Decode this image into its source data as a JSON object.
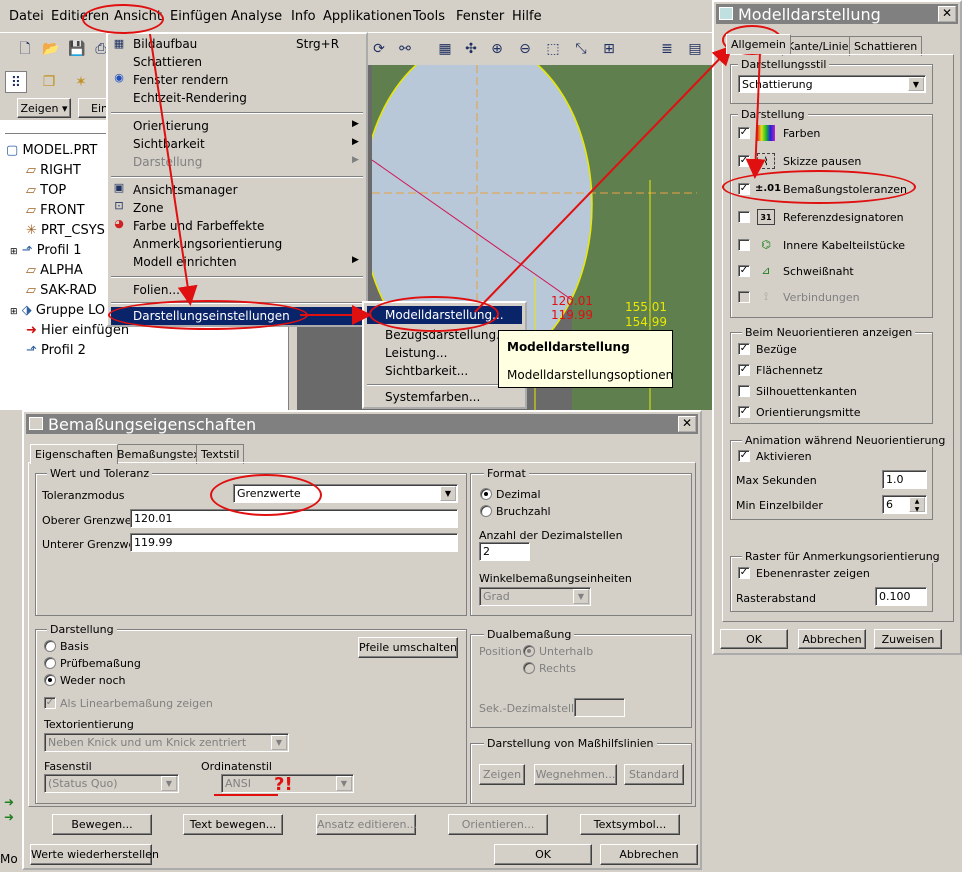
{
  "menubar": {
    "items": [
      "Datei",
      "Editieren",
      "Ansicht",
      "Einfügen",
      "Analyse",
      "Info",
      "Applikationen",
      "Tools",
      "Fenster",
      "Hilfe"
    ]
  },
  "toolbar": {
    "zeigen_label": "Zeigen ▾",
    "ein_label": "Ein"
  },
  "model_tree": {
    "items": [
      "MODEL.PRT",
      "RIGHT",
      "TOP",
      "FRONT",
      "PRT_CSYS",
      "Profil 1",
      "ALPHA",
      "SAK-RAD",
      "Gruppe LO",
      "Hier einfügen",
      "Profil 2"
    ]
  },
  "ansicht_menu": {
    "items": [
      {
        "label": "Bildaufbau",
        "shortcut": "Strg+R"
      },
      {
        "label": "Schattieren"
      },
      {
        "label": "Fenster rendern"
      },
      {
        "label": "Echtzeit-Rendering"
      },
      {
        "label": "Orientierung"
      },
      {
        "label": "Sichtbarkeit"
      },
      {
        "label": "Darstellung"
      },
      {
        "label": "Ansichtsmanager"
      },
      {
        "label": "Zone"
      },
      {
        "label": "Farbe und Farbeffekte"
      },
      {
        "label": "Anmerkungsorientierung"
      },
      {
        "label": "Modell einrichten"
      },
      {
        "label": "Folien..."
      },
      {
        "label": "Darstellungseinstellungen"
      }
    ]
  },
  "submenu": {
    "items": [
      "Modelldarstellung...",
      "Bezugsdarstellung...",
      "Leistung...",
      "Sichtbarkeit...",
      "Systemfarben..."
    ]
  },
  "tooltip": {
    "title": "Modelldarstellung",
    "text": "Modelldarstellungsoptionen"
  },
  "viewport": {
    "dim_upper_red": "120.01",
    "dim_lower_red": "119.99",
    "dim_upper_yellow": "155.01",
    "dim_lower_yellow": "154.99"
  },
  "modelldarstellung": {
    "title": "Modelldarstellung",
    "tabs": [
      "Allgemein",
      "Kante/Linie",
      "Schattieren"
    ],
    "stil_group": "Darstellungsstil",
    "stil_value": "Schattierung",
    "darstellung_group": "Darstellung",
    "darstellung_items": [
      {
        "label": "Farben",
        "checked": true,
        "disabled": false
      },
      {
        "label": "Skizze pausen",
        "checked": true,
        "disabled": false
      },
      {
        "label": "Bemaßungstoleranzen",
        "checked": true,
        "disabled": false
      },
      {
        "label": "Referenzdesignatoren",
        "checked": false,
        "disabled": false
      },
      {
        "label": "Innere Kabelteilstücke",
        "checked": false,
        "disabled": false
      },
      {
        "label": "Schweißnaht",
        "checked": true,
        "disabled": false
      },
      {
        "label": "Verbindungen",
        "checked": false,
        "disabled": true
      }
    ],
    "tol_icon_text": "±.01",
    "ref_icon_text": "31",
    "neuorient_group": "Beim Neuorientieren anzeigen",
    "neuorient_items": [
      {
        "label": "Bezüge",
        "checked": true
      },
      {
        "label": "Flächennetz",
        "checked": true
      },
      {
        "label": "Silhouettenkanten",
        "checked": false
      },
      {
        "label": "Orientierungsmitte",
        "checked": true
      }
    ],
    "animation_group": "Animation während Neuorientierung",
    "aktivieren_label": "Aktivieren",
    "max_sek_label": "Max Sekunden",
    "max_sek_value": "1.0",
    "min_bilder_label": "Min Einzelbilder",
    "min_bilder_value": "6",
    "raster_group": "Raster für Anmerkungsorientierung",
    "ebenenraster_label": "Ebenenraster zeigen",
    "rasterabstand_label": "Rasterabstand",
    "rasterabstand_value": "0.100",
    "ok_label": "OK",
    "abbrechen_label": "Abbrechen",
    "zuweisen_label": "Zuweisen"
  },
  "bemassung": {
    "title": "Bemaßungseigenschaften",
    "tabs": [
      "Eigenschaften",
      "Bemaßungstext",
      "Textstil"
    ],
    "wert_group": "Wert und Toleranz",
    "toleranzmodus_label": "Toleranzmodus",
    "toleranzmodus_value": "Grenzwerte",
    "oberer_label": "Oberer Grenzwert",
    "oberer_value": "120.01",
    "unterer_label": "Unterer Grenzwert",
    "unterer_value": "119.99",
    "format_group": "Format",
    "dezimal_label": "Dezimal",
    "bruchzahl_label": "Bruchzahl",
    "dezimalstellen_label": "Anzahl der Dezimalstellen",
    "dezimalstellen_value": "2",
    "winkel_label": "Winkelbemaßungseinheiten",
    "winkel_value": "Grad",
    "darstellung_group": "Darstellung",
    "basis_label": "Basis",
    "pruef_label": "Prüfbemaßung",
    "weder_label": "Weder noch",
    "pfeile_label": "Pfeile umschalten",
    "linear_label": "Als Linearbemaßung zeigen",
    "textorient_label": "Textorientierung",
    "textorient_value": "Neben Knick und um Knick zentriert",
    "fasenstil_label": "Fasenstil",
    "fasenstil_value": "(Status Quo)",
    "ordinaten_label": "Ordinatenstil",
    "ordinaten_value": "ANSI",
    "annotation_mark": "?!",
    "dual_group": "Dualbemaßung",
    "position_label": "Position",
    "unterhalb_label": "Unterhalb",
    "rechts_label": "Rechts",
    "sek_label": "Sek.-Dezimalstellen",
    "hilfslinien_group": "Darstellung von Maßhilfslinien",
    "zeigen_label": "Zeigen",
    "wegnehmen_label": "Wegnehmen...",
    "standard_label": "Standard",
    "bewegen_label": "Bewegen...",
    "text_bewegen_label": "Text bewegen...",
    "ansatz_label": "Ansatz editieren...",
    "orientieren_label": "Orientieren...",
    "textsymbol_label": "Textsymbol...",
    "werte_label": "Werte wiederherstellen",
    "ok_label": "OK",
    "abbrechen_label": "Abbrechen"
  },
  "statusbar": {
    "text": "Mo"
  },
  "colors": {
    "highlight": "#0a246a",
    "annotation_red": "#e01010",
    "dim_yellow": "#e8e800",
    "model_fill": "#b8c8d8",
    "background_green": "#5f7f4f"
  }
}
